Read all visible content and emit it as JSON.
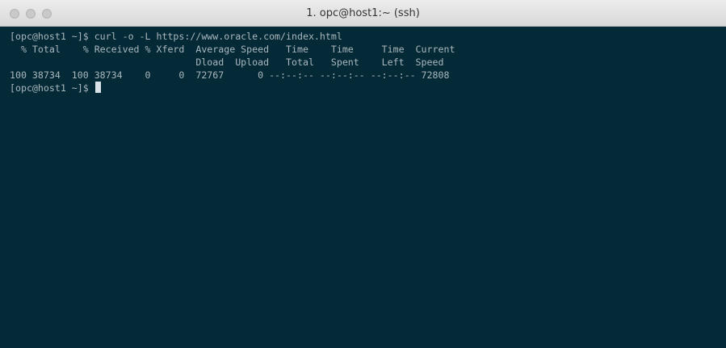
{
  "window": {
    "title": "1. opc@host1:~ (ssh)"
  },
  "terminal": {
    "lines": [
      "[opc@host1 ~]$ curl -o -L https://www.oracle.com/index.html",
      "  % Total    % Received % Xferd  Average Speed   Time    Time     Time  Current",
      "                                 Dload  Upload   Total   Spent    Left  Speed",
      "100 38734  100 38734    0     0  72767      0 --:--:-- --:--:-- --:--:-- 72808"
    ],
    "prompt": "[opc@host1 ~]$ "
  },
  "colors": {
    "terminal_bg": "#052a37",
    "terminal_text": "#a9b7bd",
    "titlebar": "#e3e3e3"
  }
}
